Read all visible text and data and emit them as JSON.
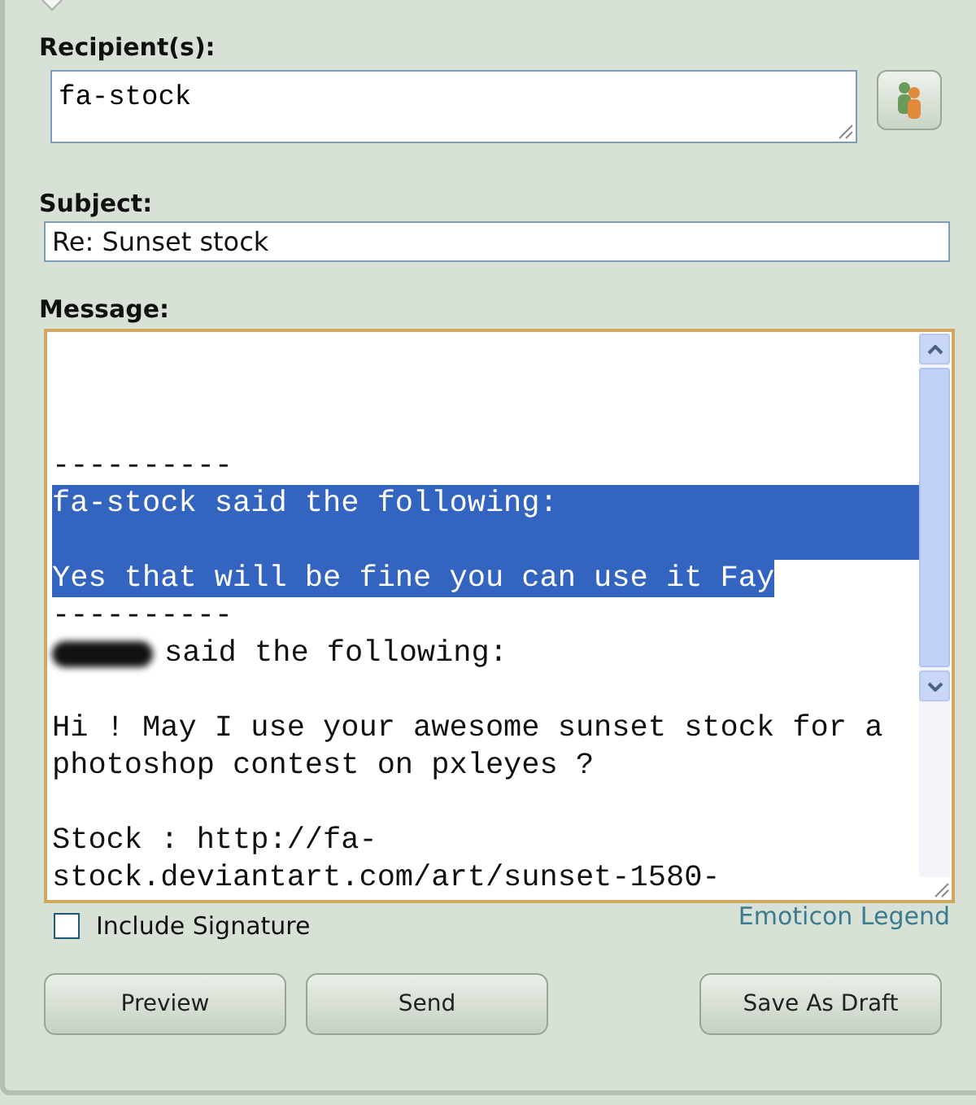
{
  "recipients": {
    "label": "Recipient(s):",
    "value": "fa-stock"
  },
  "subject": {
    "label": "Subject:",
    "value": "Re: Sunset stock"
  },
  "message": {
    "label": "Message:",
    "lines": [
      {
        "selected": false
      },
      {
        "selected": false
      },
      {
        "selected": false
      },
      {
        "text": "----------",
        "selected": false
      },
      {
        "text": "fa-stock said the following:",
        "selected": true
      },
      {
        "selected": true
      },
      {
        "text": "Yes that will be fine you can use it Fay",
        "selected": true
      },
      {
        "text": "----------",
        "selected": false
      },
      {
        "text": "said the following:",
        "selected": false,
        "redacted": true
      },
      {
        "selected": false
      },
      {
        "text": "Hi ! May I use your awesome sunset stock for a",
        "selected": false
      },
      {
        "text": "photoshop contest on pxleyes ?",
        "selected": false
      },
      {
        "selected": false
      },
      {
        "text": "Stock : http://fa-",
        "selected": false
      },
      {
        "text": "stock.deviantart.com/art/sunset-1580-",
        "selected": false
      }
    ]
  },
  "include_signature": {
    "label": "Include Signature",
    "checked": false
  },
  "emoticon_link": "Emoticon Legend",
  "buttons": [
    "Preview",
    "Send",
    "Save As Draft"
  ]
}
